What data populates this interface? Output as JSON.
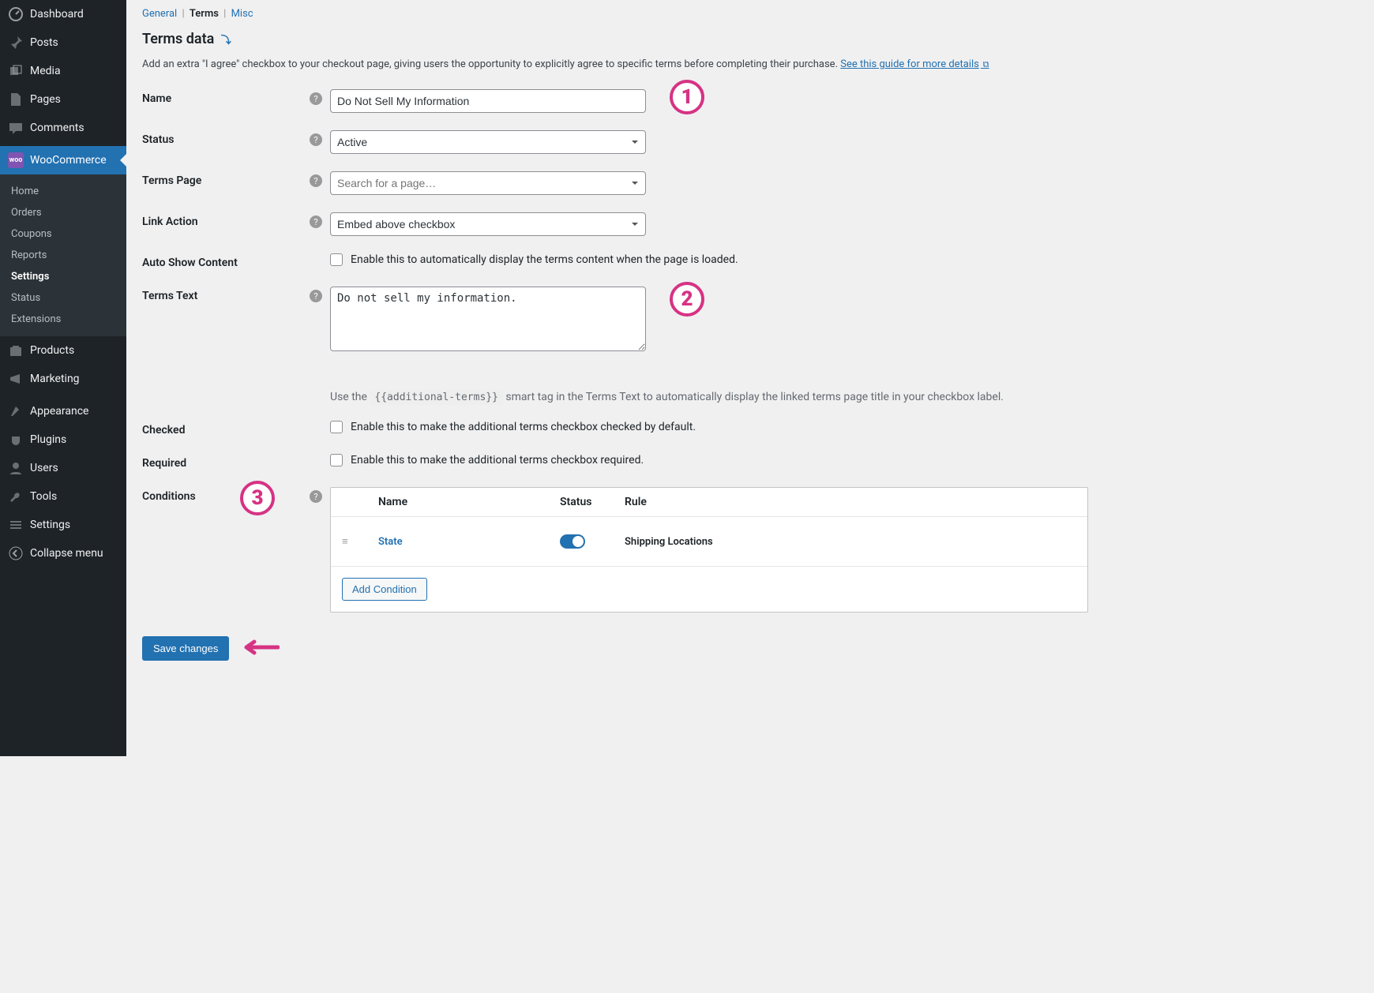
{
  "sidebar": {
    "items": [
      {
        "icon": "dashboard",
        "label": "Dashboard"
      },
      {
        "icon": "pin",
        "label": "Posts"
      },
      {
        "icon": "media",
        "label": "Media"
      },
      {
        "icon": "page",
        "label": "Pages"
      },
      {
        "icon": "comment",
        "label": "Comments"
      },
      {
        "icon": "woo",
        "label": "WooCommerce"
      }
    ],
    "woo_sub": [
      "Home",
      "Orders",
      "Coupons",
      "Reports",
      "Settings",
      "Status",
      "Extensions"
    ],
    "items2": [
      {
        "icon": "product",
        "label": "Products"
      },
      {
        "icon": "marketing",
        "label": "Marketing"
      }
    ],
    "items3": [
      {
        "icon": "appearance",
        "label": "Appearance"
      },
      {
        "icon": "plugin",
        "label": "Plugins"
      },
      {
        "icon": "user",
        "label": "Users"
      },
      {
        "icon": "tool",
        "label": "Tools"
      },
      {
        "icon": "settings",
        "label": "Settings"
      },
      {
        "icon": "collapse",
        "label": "Collapse menu"
      }
    ]
  },
  "tabs": {
    "general": "General",
    "terms": "Terms",
    "misc": "Misc"
  },
  "page": {
    "title": "Terms data",
    "anchor": "⤵",
    "desc": "Add an extra \"I agree\" checkbox to your checkout page, giving users the opportunity to explicitly agree to specific terms before completing their purchase. ",
    "guide_link": "See this guide for more details"
  },
  "form": {
    "name_label": "Name",
    "name_value": "Do Not Sell My Information",
    "status_label": "Status",
    "status_value": "Active",
    "termspage_label": "Terms Page",
    "termspage_placeholder": "Search for a page…",
    "linkaction_label": "Link Action",
    "linkaction_value": "Embed above checkbox",
    "autoshow_label": "Auto Show Content",
    "autoshow_text": "Enable this to automatically display the terms content when the page is loaded.",
    "termstext_label": "Terms Text",
    "termstext_value": "Do not sell my information.",
    "hint_pre": "Use the ",
    "hint_code": "{{additional-terms}}",
    "hint_post": " smart tag in the Terms Text to automatically display the linked terms page title in your checkbox label.",
    "checked_label": "Checked",
    "checked_text": "Enable this to make the additional terms checkbox checked by default.",
    "required_label": "Required",
    "required_text": "Enable this to make the additional terms checkbox required.",
    "conditions_label": "Conditions"
  },
  "conditions": {
    "head_name": "Name",
    "head_status": "Status",
    "head_rule": "Rule",
    "row_name": "State",
    "row_rule": "Shipping Locations",
    "add_btn": "Add Condition"
  },
  "save_btn": "Save changes",
  "callouts": {
    "c1": "1",
    "c2": "2",
    "c3": "3"
  }
}
